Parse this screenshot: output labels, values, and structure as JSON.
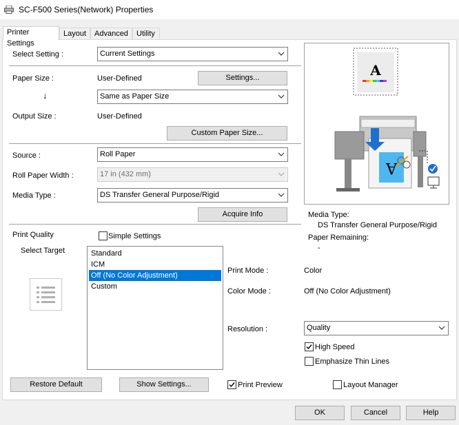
{
  "window": {
    "title": "SC-F500 Series(Network) Properties"
  },
  "tabs": [
    {
      "label": "Printer Settings",
      "active": true
    },
    {
      "label": "Layout"
    },
    {
      "label": "Advanced"
    },
    {
      "label": "Utility"
    }
  ],
  "select_setting": {
    "label": "Select Setting :",
    "value": "Current Settings"
  },
  "paper_size": {
    "label": "Paper Size :",
    "value": "User-Defined",
    "settings_button": "Settings...",
    "arrow": "↓",
    "output_combo": "Same as Paper Size"
  },
  "output_size": {
    "label": "Output Size :",
    "value": "User-Defined",
    "custom_button": "Custom Paper Size..."
  },
  "source": {
    "label": "Source :",
    "value": "Roll Paper"
  },
  "roll_width": {
    "label": "Roll Paper Width :",
    "value": "17 in (432 mm)"
  },
  "media_type": {
    "label": "Media Type :",
    "value": "DS Transfer General Purpose/Rigid",
    "acquire_button": "Acquire Info"
  },
  "print_quality": {
    "label": "Print Quality",
    "simple_settings": {
      "label": "Simple Settings",
      "checked": false
    },
    "select_target_label": "Select Target",
    "targets": [
      "Standard",
      "ICM",
      "Off (No Color Adjustment)",
      "Custom"
    ],
    "selected_index": 2
  },
  "modes": {
    "print_mode_label": "Print Mode :",
    "print_mode_value": "Color",
    "color_mode_label": "Color Mode :",
    "color_mode_value": "Off (No Color Adjustment)",
    "resolution_label": "Resolution :",
    "resolution_value": "Quality",
    "high_speed": {
      "label": "High Speed",
      "checked": true
    },
    "thin_lines": {
      "label": "Emphasize Thin Lines",
      "checked": false
    }
  },
  "preview": {
    "media_type_label": "Media Type:",
    "media_type_value": "DS Transfer General Purpose/Rigid",
    "paper_remaining_label": "Paper Remaining:",
    "paper_remaining_value": "-",
    "paper_glyph": "A"
  },
  "bottom": {
    "restore_default": "Restore Default",
    "show_settings": "Show Settings...",
    "print_preview": {
      "label": "Print Preview",
      "checked": true
    },
    "layout_manager": {
      "label": "Layout Manager",
      "checked": false
    }
  },
  "dialog_buttons": {
    "ok": "OK",
    "cancel": "Cancel",
    "help": "Help"
  },
  "colors": {
    "selection": "#0078d7",
    "accent_blue": "#1e6fd0",
    "light_blue": "#4fb7ef"
  }
}
